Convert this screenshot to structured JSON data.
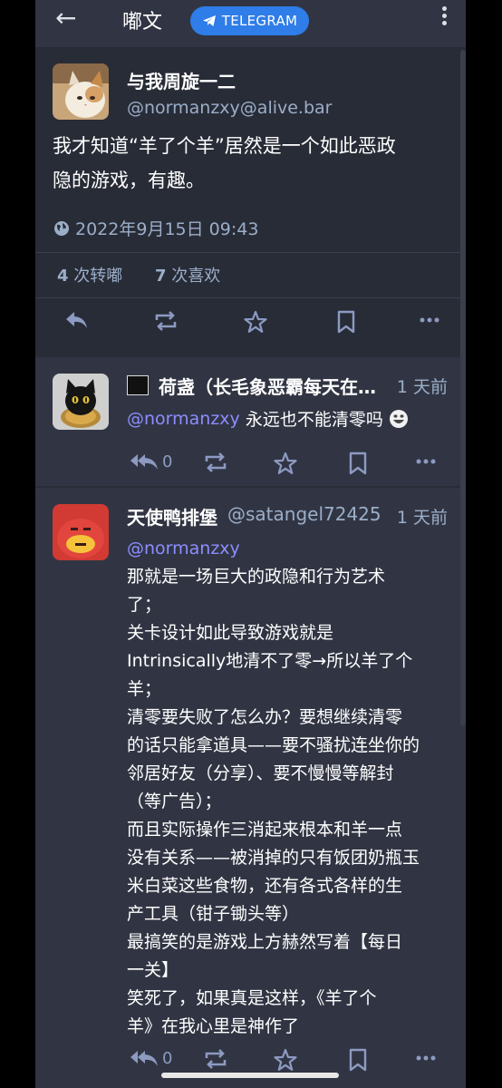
{
  "header": {
    "back_icon": "←",
    "title": "嘟文",
    "telegram_label": "TELEGRAM"
  },
  "status": {
    "display_name": "与我周旋一二",
    "handle": "@normanzxy@alive.bar",
    "lines": [
      "我才知道“羊了个羊”居然是一个如此恶政",
      "隐的游戏，有趣。"
    ],
    "date": "2022年9月15日 09:43",
    "boost_count": "4",
    "boost_label": "次转嘟",
    "fav_count": "7",
    "fav_label": "次喜欢"
  },
  "replies": [
    {
      "display_name": "荷盏（长毛象恶霸每天在…",
      "time": "1 天前",
      "mention": "@normanzxy",
      "text": "永远也不能清零吗",
      "reply_count": "0"
    },
    {
      "display_name": "天使鸭排堡",
      "handle": "@satangel72425",
      "time": "1 天前",
      "mention": "@normanzxy",
      "lines": [
        "那就是一场巨大的政隐和行为艺术",
        "了；",
        "关卡设计如此导致游戏就是",
        "Intrinsically地清不了零→所以羊了个",
        "羊；",
        "清零要失败了怎么办？要想继续清零",
        "的话只能拿道具——要不骚扰连坐你的",
        "邻居好友（分享）、要不慢慢等解封",
        "（等广告）；",
        "而且实际操作三消起来根本和羊一点",
        "没有关系——被消掉的只有饭团奶瓶玉",
        "米白菜这些食物，还有各式各样的生",
        "产工具（钳子锄头等）",
        "最搞笑的是游戏上方赫然写着【每日",
        "一关】",
        "笑死了，如果真是这样，《羊了个",
        "羊》在我心里是神作了"
      ],
      "reply_count": "0"
    }
  ],
  "colors": {
    "accent": "#2e7de9",
    "background": "#282c37",
    "mention": "#8c8dff",
    "muted": "#9baec8"
  }
}
